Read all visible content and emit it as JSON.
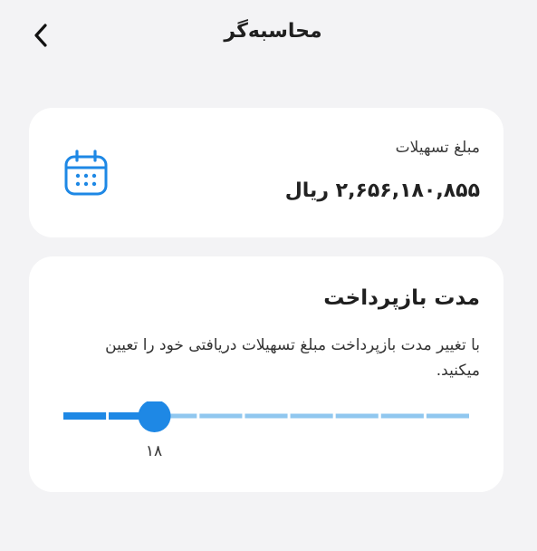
{
  "header": {
    "title": "محاسبه‌گر",
    "back_icon": "chevron-left-icon"
  },
  "loan": {
    "label": "مبلغ تسهیلات",
    "amount": "۲,۶۵۶,۱۸۰,۸۵۵ ریال",
    "icon": "calendar-icon"
  },
  "duration": {
    "title": "مدت بازپرداخت",
    "description": "با تغییر مدت بازپرداخت مبلغ تسهیلات دریافتی خود را تعیین میکنید.",
    "slider": {
      "value_label": "۱۸",
      "position": 0.22,
      "segments": 9,
      "active_color": "#1e88e5",
      "track_color": "#90c7ef"
    }
  },
  "colors": {
    "accent": "#1e88e5",
    "background": "#f3f3f5",
    "card": "#ffffff"
  }
}
